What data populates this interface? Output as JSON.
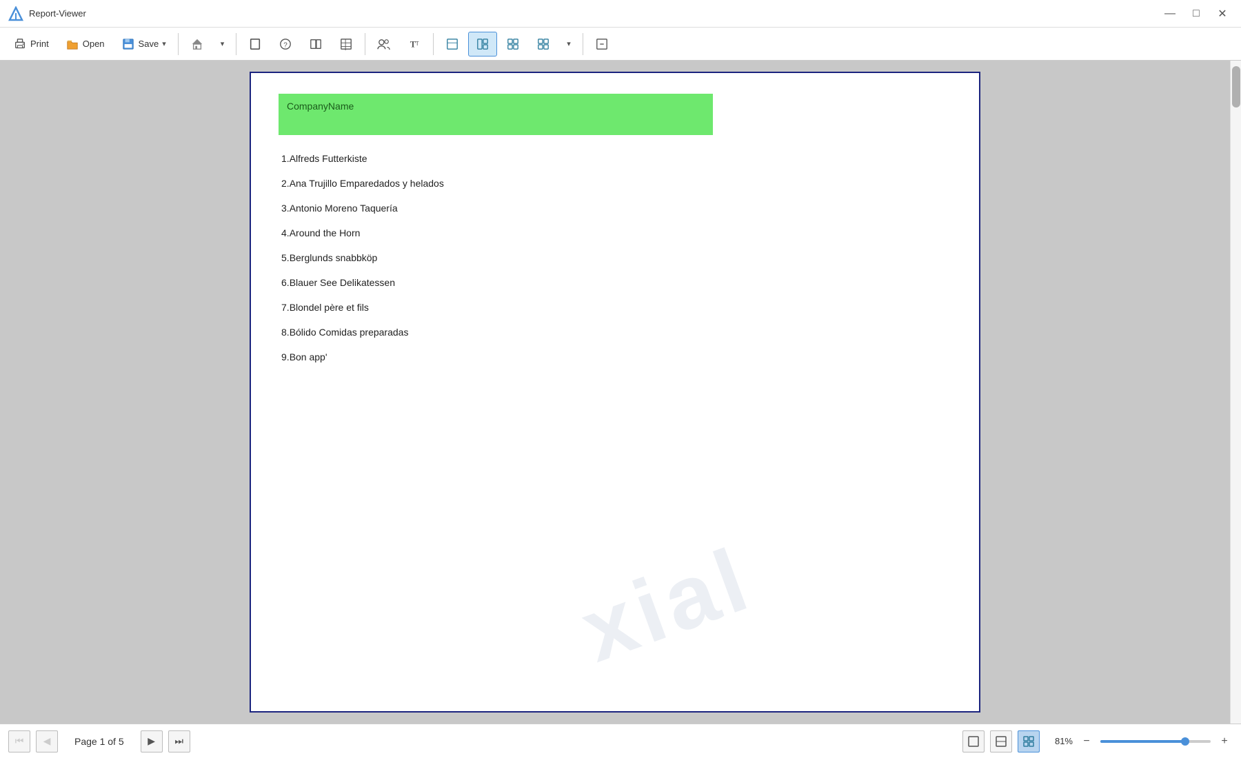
{
  "titlebar": {
    "title": "Report-Viewer",
    "minimize_label": "—",
    "maximize_label": "□",
    "close_label": "✕"
  },
  "toolbar": {
    "print_label": "Print",
    "open_label": "Open",
    "save_label": "Save",
    "save_dropdown": true
  },
  "document": {
    "header": {
      "column_label": "CompanyName"
    },
    "watermark": "xial",
    "companies": [
      {
        "index": 1,
        "name": "Alfreds Futterkiste"
      },
      {
        "index": 2,
        "name": "Ana Trujillo Emparedados y helados"
      },
      {
        "index": 3,
        "name": "Antonio Moreno Taquería"
      },
      {
        "index": 4,
        "name": "Around the Horn"
      },
      {
        "index": 5,
        "name": "Berglunds snabbköp"
      },
      {
        "index": 6,
        "name": "Blauer See Delikatessen"
      },
      {
        "index": 7,
        "name": "Blondel père et fils"
      },
      {
        "index": 8,
        "name": "Bólido Comidas preparadas"
      },
      {
        "index": 9,
        "name": "Bon app'"
      }
    ]
  },
  "bottombar": {
    "page_info": "Page 1 of 5",
    "zoom_percent": "81%"
  },
  "icons": {
    "print": "🖨",
    "open_folder": "📂",
    "save": "💾",
    "home": "🏠",
    "chevron_down": "▾",
    "search_people": "👥",
    "text_style": "T",
    "page_view": "▣",
    "layout1": "⊞",
    "layout2": "⊟",
    "layout3": "⊠",
    "layout4": "⊞",
    "nav_first": "⏮",
    "nav_prev": "◀",
    "nav_next": "▶",
    "nav_last": "⏭",
    "fit_page": "⊡",
    "fit_width": "⊞",
    "multi_page": "⊞"
  }
}
